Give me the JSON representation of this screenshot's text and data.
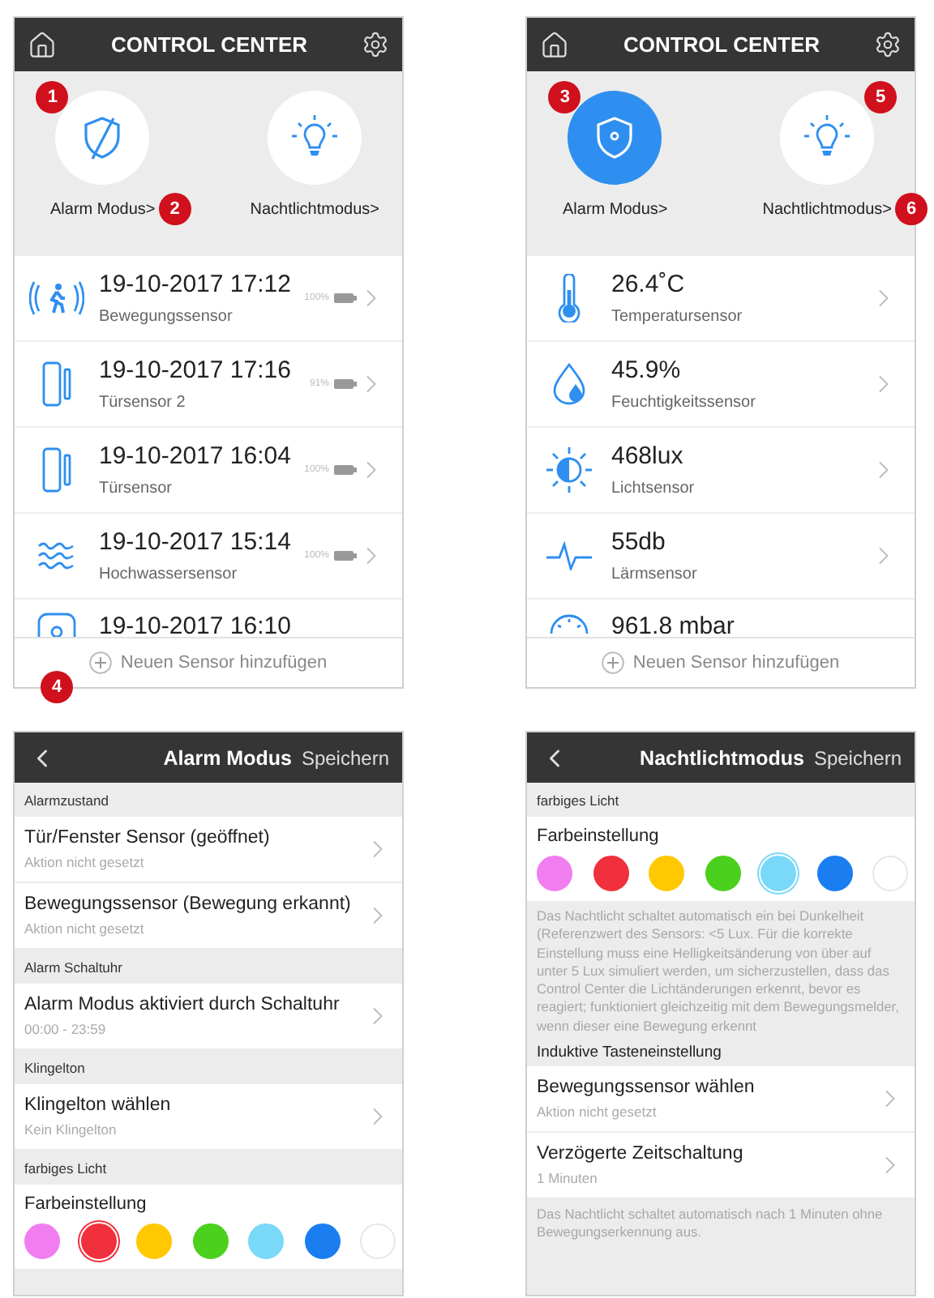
{
  "screens": [
    {
      "kind": "control",
      "title": "CONTROL CENTER",
      "modes": [
        {
          "kind": "alarm",
          "label": "Alarm Modus>",
          "active": false,
          "icon_marker": "1",
          "label_marker": "2"
        },
        {
          "kind": "nightlight",
          "label": "Nachtlichtmodus>",
          "active": false
        }
      ],
      "sensors": [
        {
          "kind": "motion",
          "value": "19-10-2017 17:12",
          "name": "Bewegungssensor",
          "battery": "100%"
        },
        {
          "kind": "door",
          "value": "19-10-2017 17:16",
          "name": "Türsensor 2",
          "battery": "91%"
        },
        {
          "kind": "door",
          "value": "19-10-2017 16:04",
          "name": "Türsensor",
          "battery": "100%"
        },
        {
          "kind": "water",
          "value": "19-10-2017 15:14",
          "name": "Hochwassersensor",
          "battery": "100%"
        },
        {
          "kind": "device",
          "value": "19-10-2017 16:10"
        }
      ],
      "add": {
        "label": "Neuen Sensor hinzufügen",
        "marker": "4"
      }
    },
    {
      "kind": "control",
      "title": "CONTROL CENTER",
      "modes": [
        {
          "kind": "alarm",
          "label": "Alarm Modus>",
          "active": true,
          "icon_marker": "3"
        },
        {
          "kind": "nightlight",
          "label": "Nachtlichtmodus>",
          "active": false,
          "icon_marker": "5",
          "label_marker": "6"
        }
      ],
      "sensors": [
        {
          "kind": "thermometer",
          "value": "26.4˚C",
          "name": "Temperatursensor"
        },
        {
          "kind": "droplet",
          "value": "45.9%",
          "name": "Feuchtigkeitssensor"
        },
        {
          "kind": "light",
          "value": "468lux",
          "name": "Lichtsensor"
        },
        {
          "kind": "sound",
          "value": "55db",
          "name": "Lärmsensor"
        },
        {
          "kind": "gauge",
          "value": "961.8 mbar"
        }
      ],
      "add": {
        "label": "Neuen Sensor hinzufügen"
      }
    },
    {
      "kind": "settings",
      "title": "Alarm Modus",
      "action": "Speichern",
      "blocks": [
        {
          "kind": "header",
          "text": "Alarmzustand",
          "strong": false
        },
        {
          "kind": "row",
          "title": "Tür/Fenster Sensor (geöffnet)",
          "subtitle": "Aktion nicht gesetzt"
        },
        {
          "kind": "row",
          "title": "Bewegungssensor (Bewegung erkannt)",
          "subtitle": "Aktion nicht gesetzt"
        },
        {
          "kind": "header",
          "text": "Alarm Schaltuhr",
          "strong": false
        },
        {
          "kind": "row",
          "title": "Alarm Modus aktiviert durch Schaltuhr",
          "subtitle": "00:00 - 23:59"
        },
        {
          "kind": "header",
          "text": "Klingelton",
          "strong": false
        },
        {
          "kind": "row",
          "title": "Klingelton wählen",
          "subtitle": "Kein Klingelton"
        },
        {
          "kind": "header",
          "text": "farbiges Licht",
          "strong": false
        },
        {
          "kind": "colors",
          "label": "Farbeinstellung",
          "colors": [
            {
              "color": "#f07ef0",
              "selected": false
            },
            {
              "color": "#f0303c",
              "selected": true
            },
            {
              "color": "#ffc800",
              "selected": false
            },
            {
              "color": "#4cd01e",
              "selected": false
            },
            {
              "color": "#7ad8f8",
              "selected": false
            },
            {
              "color": "#1a7ef0",
              "selected": false
            },
            {
              "color": "#ffffff",
              "selected": false
            }
          ]
        }
      ]
    },
    {
      "kind": "settings",
      "title": "Nachtlichtmodus",
      "action": "Speichern",
      "blocks": [
        {
          "kind": "header",
          "text": "farbiges Licht",
          "strong": false
        },
        {
          "kind": "colors",
          "label": "Farbeinstellung",
          "colors": [
            {
              "color": "#f07ef0",
              "selected": false
            },
            {
              "color": "#f0303c",
              "selected": false
            },
            {
              "color": "#ffc800",
              "selected": false
            },
            {
              "color": "#4cd01e",
              "selected": false
            },
            {
              "color": "#7ad8f8",
              "selected": true
            },
            {
              "color": "#1a7ef0",
              "selected": false
            },
            {
              "color": "#ffffff",
              "selected": false
            }
          ]
        },
        {
          "kind": "note",
          "text": "Das Nachtlicht schaltet automatisch ein bei Dunkelheit (Referenzwert des Sensors: <5 Lux. Für die korrekte Einstellung muss eine Helligkeitsänderung von über auf unter 5 Lux simuliert werden, um sicherzustellen, dass das Control Center die Lichtänderungen erkennt, bevor es reagiert; funktioniert gleichzeitig mit dem Bewegungsmelder, wenn dieser eine Bewegung erkennt"
        },
        {
          "kind": "header",
          "text": "Induktive Tasteneinstellung",
          "strong": true
        },
        {
          "kind": "row",
          "title": "Bewegungssensor wählen",
          "subtitle": "Aktion nicht gesetzt"
        },
        {
          "kind": "row",
          "title": "Verzögerte Zeitschaltung",
          "subtitle": "1 Minuten"
        },
        {
          "kind": "note",
          "text": "Das Nachtlicht schaltet automatisch nach 1 Minuten ohne Bewegungserkennung aus."
        }
      ]
    }
  ]
}
